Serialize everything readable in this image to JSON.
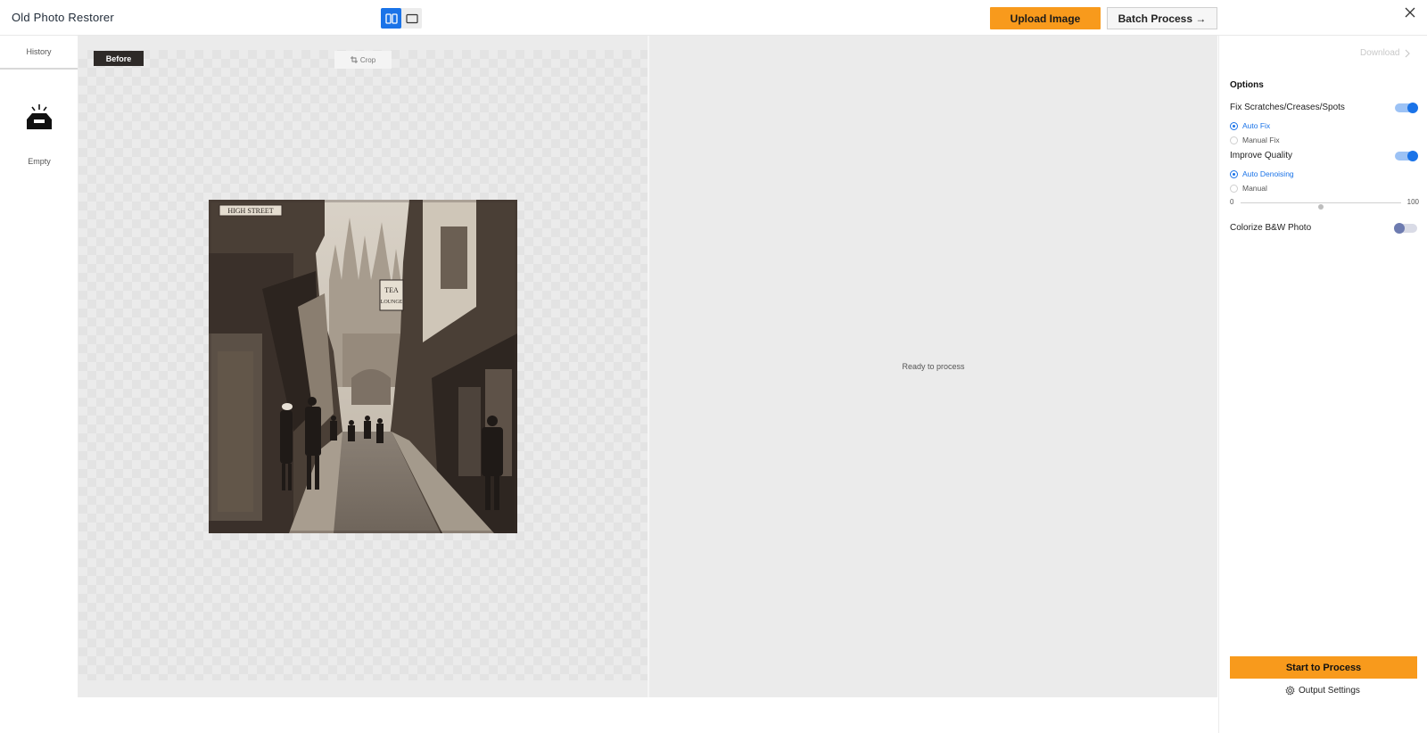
{
  "header": {
    "app_title": "Old Photo Restorer",
    "view_modes": [
      "split-view-icon",
      "single-view-icon"
    ],
    "active_view": "split",
    "upload_label": "Upload Image",
    "batch_label": "Batch Process →"
  },
  "history": {
    "tab_label": "History",
    "empty_label": "Empty"
  },
  "before": {
    "badge": "Before",
    "crop_label": "Crop"
  },
  "after": {
    "status": "Ready to process"
  },
  "options": {
    "download_label": "Download",
    "title": "Options",
    "fix_scratches": {
      "label": "Fix Scratches/Creases/Spots",
      "enabled": true
    },
    "fix_modes": [
      {
        "label": "Auto Fix",
        "checked": true
      },
      {
        "label": "Manual Fix",
        "checked": false
      }
    ],
    "improve_quality": {
      "label": "Improve Quality",
      "enabled": true
    },
    "quality_modes": [
      {
        "label": "Auto Denoising",
        "checked": true
      },
      {
        "label": "Manual",
        "checked": false
      }
    ],
    "slider": {
      "min_label": "0",
      "max_label": "100",
      "value": 50
    },
    "colorize": {
      "label": "Colorize B&W Photo",
      "enabled": false
    },
    "start_label": "Start to Process",
    "output_settings_label": "Output Settings"
  },
  "colors": {
    "accent_orange": "#f89a1c",
    "accent_blue": "#1a73e8",
    "canvas_bg": "#ebebeb"
  }
}
